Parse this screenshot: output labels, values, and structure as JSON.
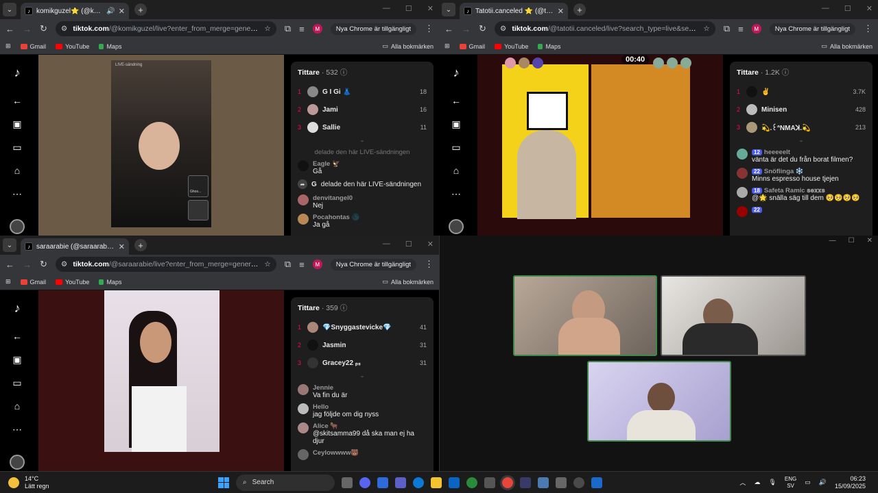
{
  "windows": [
    {
      "tab_title": "komikguzel⭐ (@komikguz",
      "url_host": "tiktok.com",
      "url_path": "/@komikguzel/live?enter_from_merge=general_search&e...",
      "chrome_pill": "Nya Chrome är tillgängligt",
      "bookmarks": [
        "Gmail",
        "YouTube",
        "Maps"
      ],
      "all_bookmarks": "Alla bokmärken",
      "panel_title": "Tittare",
      "panel_count": "· 532",
      "viewers": [
        {
          "rank": "1",
          "name": "G I Gi 👗",
          "score": "18"
        },
        {
          "rank": "2",
          "name": "Jami",
          "score": "16"
        },
        {
          "rank": "3",
          "name": "Sallie",
          "score": "11"
        }
      ],
      "faded_line": "delade den här LIVE-sändningen",
      "comments": [
        {
          "user": "Eagle 🦅",
          "text": "Gå"
        }
      ],
      "share_line": {
        "user": "G",
        "text": "delade den här LIVE-sändningen"
      },
      "comments2": [
        {
          "user": "denvitangel0",
          "text": "Nej"
        },
        {
          "user": "Pocahontas 🌑",
          "text": "Ja gå"
        }
      ],
      "stage_label": "LIVE-sändning",
      "mini_label": "Ghos..."
    },
    {
      "tab_title": "Tatotii.canceled ⭐ (@tatotii.ca",
      "url_host": "tiktok.com",
      "url_path": "/@tatotii.canceled/live?search_type=live&search_id=2025...",
      "chrome_pill": "Nya Chrome är tillgängligt",
      "bookmarks": [
        "Gmail",
        "YouTube",
        "Maps"
      ],
      "all_bookmarks": "Alla bokmärken",
      "panel_title": "Tittare",
      "panel_count": "· 1.2K",
      "timer": "00:40",
      "viewers": [
        {
          "rank": "1",
          "name": "✌️",
          "score": "3.7K"
        },
        {
          "rank": "2",
          "name": "Minisen",
          "score": "428"
        },
        {
          "rank": "3",
          "name": "💫.꒰ᐢNMAꓘ.💫",
          "score": "213"
        }
      ],
      "comments": [
        {
          "badge": "12",
          "user": "heeeeelt",
          "text": "vänta är det du från borat filmen?"
        },
        {
          "badge": "22",
          "user": "Snöflinga ❄️",
          "text": "Minns espresso house tjejen"
        },
        {
          "badge": "18",
          "user": "Safeta Ramic 𝐬𝐞𝐱𝐱𝐬",
          "text": "@🌟 snälla säg till dem 🥺🥺🥺🥺"
        },
        {
          "badge": "22",
          "user": "",
          "text": ""
        }
      ]
    },
    {
      "tab_title": "saraarabie (@saraarabie) är LIV",
      "url_host": "tiktok.com",
      "url_path": "/@saraarabie/live?enter_from_merge=general_search&en...",
      "chrome_pill": "Nya Chrome är tillgängligt",
      "bookmarks": [
        "Gmail",
        "YouTube",
        "Maps"
      ],
      "all_bookmarks": "Alla bokmärken",
      "panel_title": "Tittare",
      "panel_count": "· 359",
      "viewers": [
        {
          "rank": "1",
          "name": "💎Snyggastevicke💎",
          "score": "41"
        },
        {
          "rank": "2",
          "name": "Jasmin",
          "score": "31"
        },
        {
          "rank": "3",
          "name": "Gracey22 ₚₛ",
          "score": "31"
        }
      ],
      "comments": [
        {
          "user": "Jennie",
          "text": "Va fin du är"
        },
        {
          "user": "Hello",
          "text": "jag följde om dig nyss"
        },
        {
          "user": "Alice 🐂",
          "text": "@skitsamma99 då ska man ej ha djur"
        },
        {
          "user": "Ceylowwww🐻",
          "text": ""
        }
      ]
    }
  ],
  "taskbar": {
    "temp": "14°C",
    "weather": "Lätt regn",
    "search": "Search",
    "lang_top": "ENG",
    "lang_bottom": "SV",
    "time": "06:23",
    "date": "15/09/2025"
  }
}
